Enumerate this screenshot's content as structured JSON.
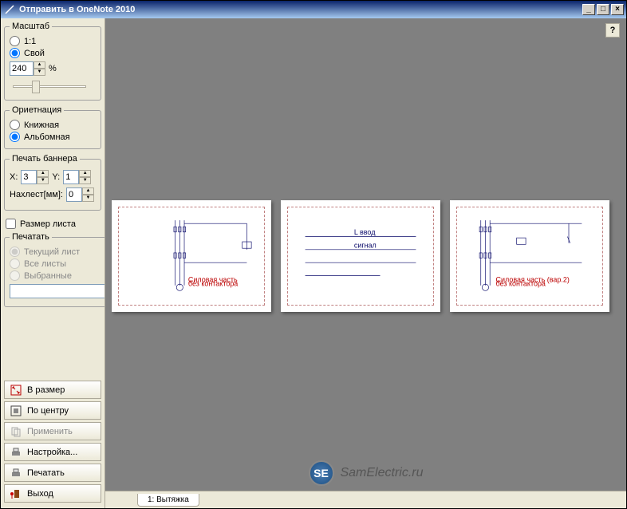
{
  "window": {
    "title": "Отправить в OneNote 2010"
  },
  "scale": {
    "legend": "Масштаб",
    "opt_1to1": "1:1",
    "opt_custom": "Свой",
    "value": "240",
    "unit": "%"
  },
  "orientation": {
    "legend": "Ориетнация",
    "opt_portrait": "Книжная",
    "opt_landscape": "Альбомная"
  },
  "banner": {
    "legend": "Печать баннера",
    "x_label": "X:",
    "x_value": "3",
    "y_label": "Y:",
    "y_value": "1",
    "overlap_label": "Нахлест[мм]:",
    "overlap_value": "0"
  },
  "sheet_size": {
    "label": "Размер листа"
  },
  "print": {
    "legend": "Печатать",
    "opt_current": "Текущий лист",
    "opt_all": "Все листы",
    "opt_selected": "Выбранные",
    "browse": "..."
  },
  "buttons": {
    "fit": "В размер",
    "center": "По центру",
    "apply": "Применить",
    "setup": "Настройка...",
    "print": "Печатать",
    "exit": "Выход"
  },
  "help": "?",
  "tab": {
    "label": "1: Вытяжка"
  },
  "watermark": {
    "logo": "SE",
    "text": "SamElectric.ru"
  }
}
